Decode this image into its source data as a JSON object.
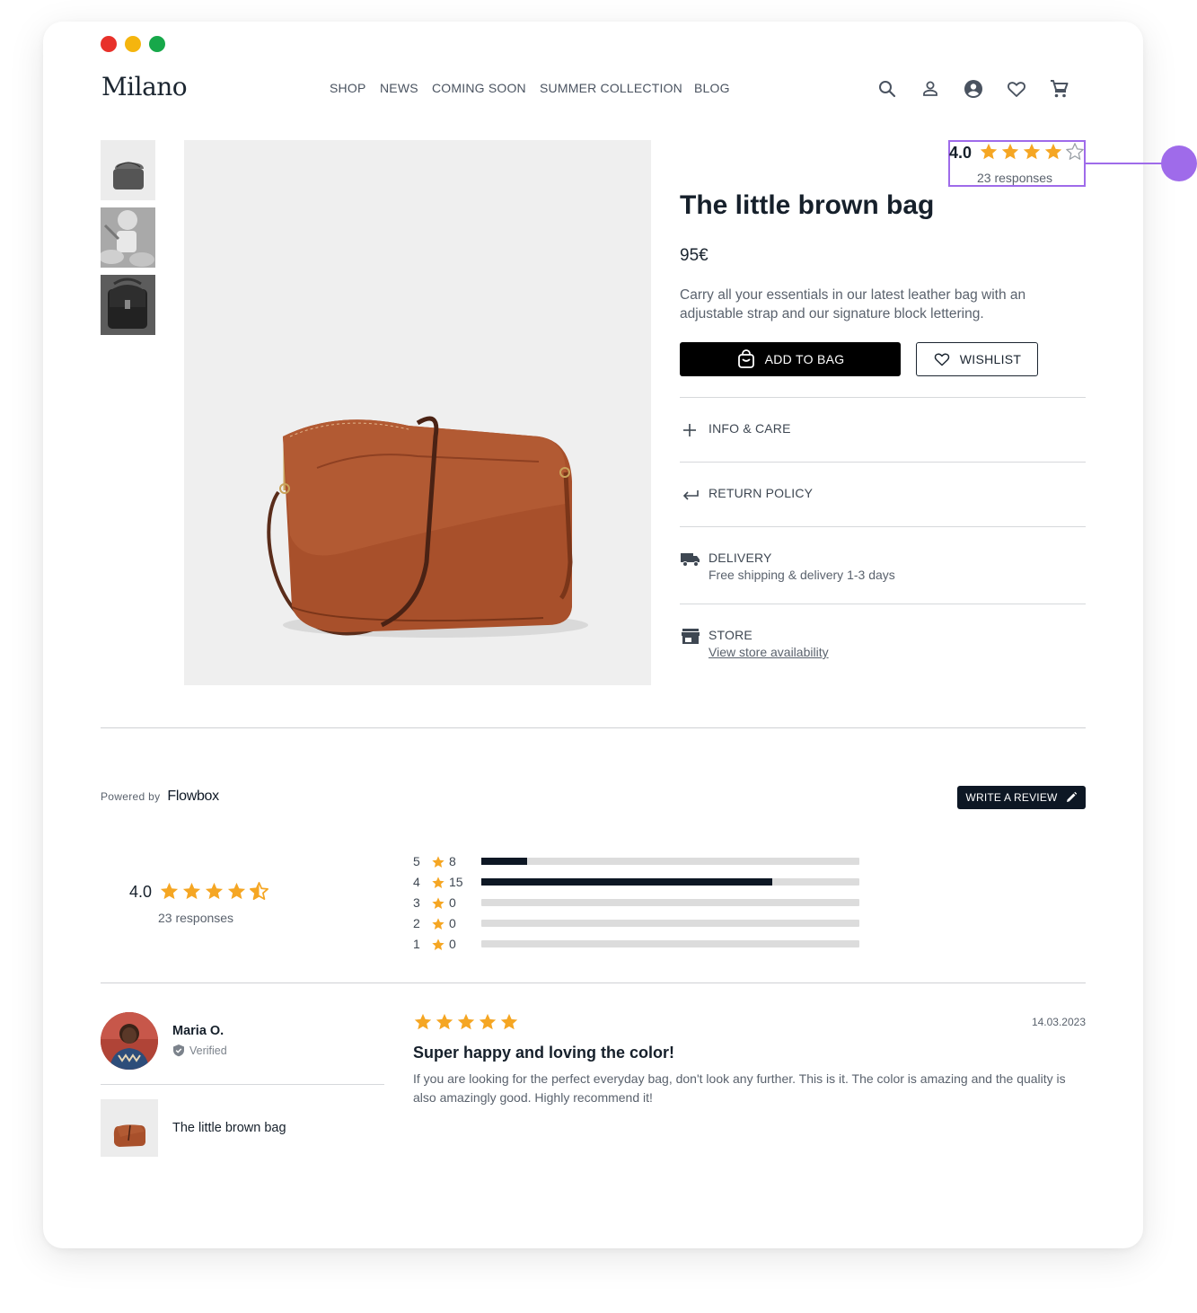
{
  "window": {
    "dots": [
      "#e8312a",
      "#f5b50e",
      "#17a84a"
    ]
  },
  "header": {
    "logo": "Milano",
    "nav": [
      "SHOP",
      "NEWS",
      "COMING SOON",
      "SUMMER COLLECTION",
      "BLOG"
    ],
    "icons": [
      "search-icon",
      "user-icon",
      "account-circle-icon",
      "heart-icon",
      "cart-icon"
    ]
  },
  "product": {
    "title": "The little brown bag",
    "price": "95€",
    "description": "Carry all your essentials in our latest leather bag with an adjustable strap and our signature block lettering.",
    "add_to_bag": "ADD TO BAG",
    "wishlist": "WISHLIST",
    "rating_badge": {
      "score": "4.0",
      "stars": 4,
      "max_stars": 5,
      "responses": "23 responses"
    },
    "accordion": [
      {
        "icon": "plus-icon",
        "label": "INFO & CARE"
      },
      {
        "icon": "return-arrow-icon",
        "label": "RETURN POLICY"
      },
      {
        "icon": "truck-icon",
        "label": "DELIVERY",
        "sub": "Free shipping & delivery 1-3 days"
      },
      {
        "icon": "store-icon",
        "label": "STORE",
        "link": "View store availability"
      }
    ]
  },
  "reviews": {
    "powered_by": "Powered by",
    "brand": "Flowbox",
    "write_review": "WRITE A REVIEW",
    "summary": {
      "score": "4.0",
      "stars": 4.5,
      "responses": "23 responses"
    },
    "distribution": [
      {
        "stars": "5",
        "count": "8",
        "fraction": 0.12
      },
      {
        "stars": "4",
        "count": "15",
        "fraction": 0.77
      },
      {
        "stars": "3",
        "count": "0",
        "fraction": 0
      },
      {
        "stars": "2",
        "count": "0",
        "fraction": 0
      },
      {
        "stars": "1",
        "count": "0",
        "fraction": 0
      }
    ],
    "review": {
      "author": "Maria O.",
      "verified": "Verified",
      "product": "The little brown bag",
      "stars": 5,
      "date": "14.03.2023",
      "title": "Super happy and loving the color!",
      "body": "If you are looking for the perfect everyday bag, don't look any further. This is it. The color is amazing and the quality is also amazingly good. Highly recommend it!"
    }
  },
  "colors": {
    "star": "#f5a623",
    "highlight": "#9f6bea",
    "dark": "#0d1724"
  }
}
